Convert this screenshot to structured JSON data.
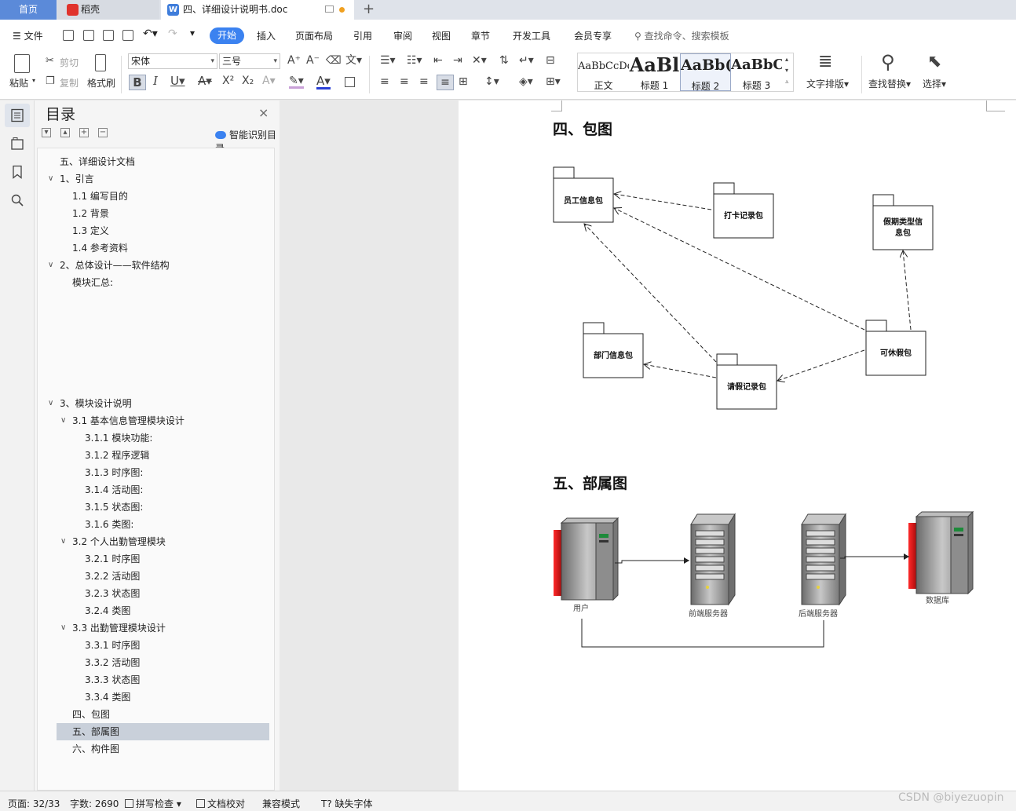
{
  "tabs": {
    "home": "首页",
    "daoke": "稻壳",
    "doc": "四、详细设计说明书.doc",
    "add": "+"
  },
  "menu": {
    "file": "文件",
    "active": "开始",
    "items": [
      "插入",
      "页面布局",
      "引用",
      "审阅",
      "视图",
      "章节",
      "开发工具",
      "会员专享"
    ],
    "search": "查找命令、搜索模板"
  },
  "ribbon": {
    "paste": "粘贴",
    "cut": "剪切",
    "copy": "复制",
    "format_painter": "格式刷",
    "font_name": "宋体",
    "font_size": "三号",
    "styles": [
      {
        "sample": "AaBbCcDd",
        "name": "正文"
      },
      {
        "sample": "AaBl",
        "name": "标题 1"
      },
      {
        "sample": "AaBb(",
        "name": "标题 2"
      },
      {
        "sample": "AaBbC",
        "name": "标题 3"
      }
    ],
    "text_layout": "文字排版",
    "find_replace": "查找替换",
    "select": "选择"
  },
  "toc": {
    "title": "目录",
    "close": "×",
    "ai": "智能识别目录",
    "items": [
      {
        "text": "五、详细设计文档",
        "level": 0,
        "caret": false
      },
      {
        "text": "1、引言",
        "level": 0,
        "caret": true
      },
      {
        "text": "1.1 编写目的",
        "level": 1,
        "caret": false
      },
      {
        "text": "1.2 背景",
        "level": 1,
        "caret": false
      },
      {
        "text": "1.3 定义",
        "level": 1,
        "caret": false
      },
      {
        "text": "1.4 参考资料",
        "level": 1,
        "caret": false
      },
      {
        "text": "2、总体设计——软件结构",
        "level": 0,
        "caret": true
      },
      {
        "text": "模块汇总:",
        "level": 1,
        "caret": false
      },
      {
        "text": "3、模块设计说明",
        "level": 0,
        "caret": true
      },
      {
        "text": "3.1  基本信息管理模块设计",
        "level": 1,
        "caret": true
      },
      {
        "text": "3.1.1 模块功能:",
        "level": 2,
        "caret": false
      },
      {
        "text": "3.1.2 程序逻辑",
        "level": 2,
        "caret": false
      },
      {
        "text": "3.1.3 时序图:",
        "level": 2,
        "caret": false
      },
      {
        "text": "3.1.4 活动图:",
        "level": 2,
        "caret": false
      },
      {
        "text": "3.1.5 状态图:",
        "level": 2,
        "caret": false
      },
      {
        "text": "3.1.6 类图:",
        "level": 2,
        "caret": false
      },
      {
        "text": "3.2 个人出勤管理模块",
        "level": 1,
        "caret": true
      },
      {
        "text": "3.2.1  时序图",
        "level": 2,
        "caret": false
      },
      {
        "text": "3.2.2  活动图",
        "level": 2,
        "caret": false
      },
      {
        "text": "3.2.3  状态图",
        "level": 2,
        "caret": false
      },
      {
        "text": "3.2.4  类图",
        "level": 2,
        "caret": false
      },
      {
        "text": "3.3 出勤管理模块设计",
        "level": 1,
        "caret": true
      },
      {
        "text": "3.3.1 时序图",
        "level": 2,
        "caret": false
      },
      {
        "text": "3.3.2 活动图",
        "level": 2,
        "caret": false
      },
      {
        "text": "3.3.3 状态图",
        "level": 2,
        "caret": false
      },
      {
        "text": "3.3.4 类图",
        "level": 2,
        "caret": false
      },
      {
        "text": "四、包图",
        "level": 1,
        "caret": false
      },
      {
        "text": "五、部属图",
        "level": 1,
        "caret": false,
        "selected": true
      },
      {
        "text": "六、构件图",
        "level": 1,
        "caret": false
      }
    ]
  },
  "document": {
    "heading1": "四、包图",
    "heading2": "五、部属图",
    "packages": {
      "employee": "员工信息包",
      "clock": "打卡记录包",
      "leave_type_1": "假期类型信",
      "leave_type_2": "息包",
      "department": "部门信息包",
      "available_leave": "可休假包",
      "leave_record": "请假记录包"
    },
    "deployment": {
      "user": "用户",
      "frontend": "前端服务器",
      "backend": "后端服务器",
      "database": "数据库"
    }
  },
  "status": {
    "page": "页面: 32/33",
    "words": "字数: 2690",
    "spell": "拼写检查",
    "proof": "文档校对",
    "compat": "兼容模式",
    "missing_font": "缺失字体"
  },
  "watermark": "CSDN @biyezuopin"
}
